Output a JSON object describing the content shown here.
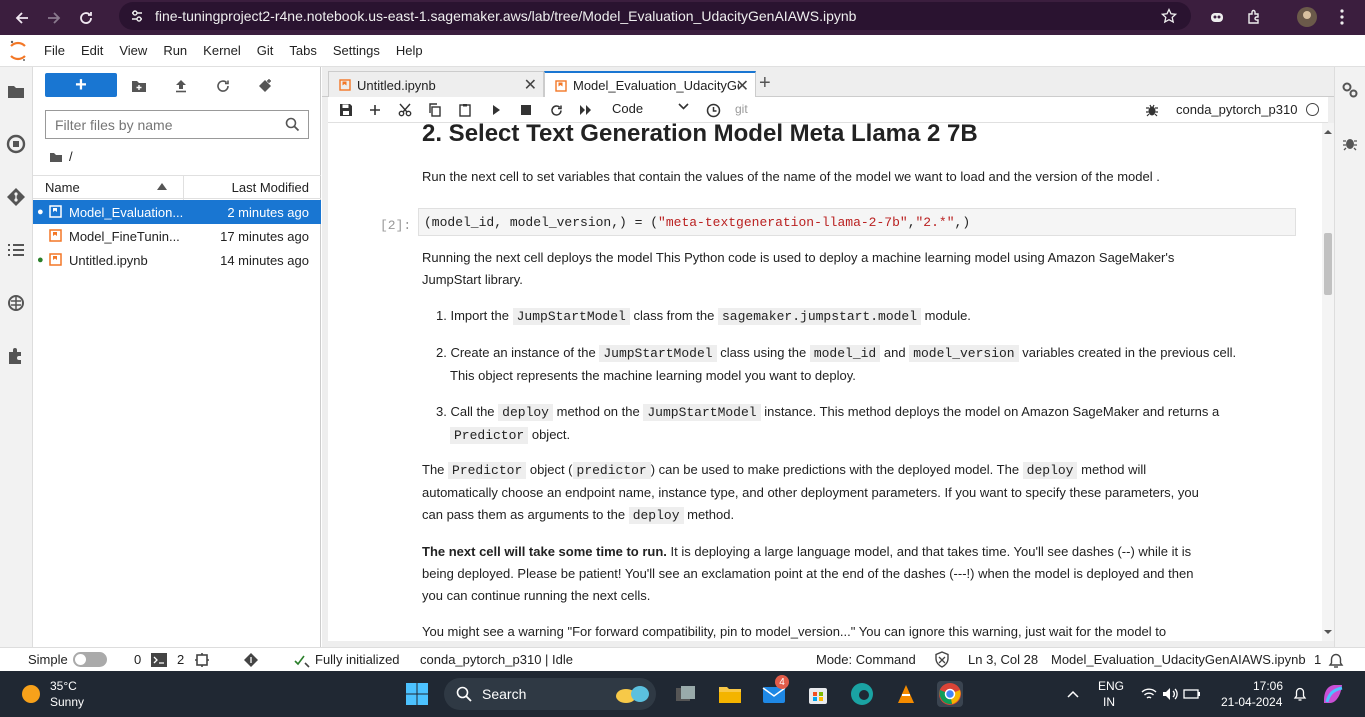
{
  "browser": {
    "url": "fine-tuningproject2-r4ne.notebook.us-east-1.sagemaker.aws/lab/tree/Model_Evaluation_UdacityGenAIAWS.ipynb"
  },
  "menu": [
    "File",
    "Edit",
    "View",
    "Run",
    "Kernel",
    "Git",
    "Tabs",
    "Settings",
    "Help"
  ],
  "file_browser": {
    "new_label": "+",
    "filter_placeholder": "Filter files by name",
    "path": "/",
    "header_name": "Name",
    "header_modified": "Last Modified",
    "files": [
      {
        "name": "Model_Evaluation...",
        "modified": "2 minutes ago",
        "running": true,
        "selected": true
      },
      {
        "name": "Model_FineTunin...",
        "modified": "17 minutes ago",
        "running": false,
        "selected": false
      },
      {
        "name": "Untitled.ipynb",
        "modified": "14 minutes ago",
        "running": true,
        "selected": false
      }
    ]
  },
  "tabs": [
    {
      "label": "Untitled.ipynb",
      "active": false
    },
    {
      "label": "Model_Evaluation_UdacityGe",
      "active": true
    }
  ],
  "toolbar": {
    "cell_type": "Code",
    "git": "git",
    "kernel": "conda_pytorch_p310"
  },
  "notebook": {
    "heading": "2. Select Text Generation Model Meta Llama 2 7B",
    "p1": "Run the next cell to set variables that contain the values of the name of the model we want to load and the version of the model .",
    "prompt": "[2]:",
    "code_pre": "(model_id, model_version,) = (",
    "code_str1": "\"meta-textgeneration-llama-2-7b\"",
    "code_mid": ",",
    "code_str2": "\"2.*\"",
    "code_post": ",)",
    "p2a": "Running the next cell deploys the model This Python code is used to deploy a machine learning model using Amazon SageMaker's",
    "p2b": "JumpStart library.",
    "li1_a": "1. Import the",
    "li1_c1": "JumpStartModel",
    "li1_b": "class from the",
    "li1_c2": "sagemaker.jumpstart.model",
    "li1_d": "module.",
    "li2_a": "2. Create an instance of the",
    "li2_c1": "JumpStartModel",
    "li2_b": "class using the",
    "li2_c2": "model_id",
    "li2_and": "and",
    "li2_c3": "model_version",
    "li2_d": "variables created in the previous cell.",
    "li2_e": "This object represents the machine learning model you want to deploy.",
    "li3_a": "3. Call the",
    "li3_c1": "deploy",
    "li3_b": "method on the",
    "li3_c2": "JumpStartModel",
    "li3_d": "instance. This method deploys the model on Amazon SageMaker and returns a",
    "li3_c3": "Predictor",
    "li3_e": "object.",
    "p3_a": "The",
    "p3_c1": "Predictor",
    "p3_b": "object (",
    "p3_c2": "predictor",
    "p3_c": ") can be used to make predictions with the deployed model. The",
    "p3_c3": "deploy",
    "p3_d": "method will",
    "p3_e": "automatically choose an endpoint name, instance type, and other deployment parameters. If you want to specify these parameters, you",
    "p3_f": "can pass them as arguments to the",
    "p3_c4": "deploy",
    "p3_g": "method.",
    "p4_bold": "The next cell will take some time to run.",
    "p4_a": " It is deploying a large language model, and that takes time. You'll see dashes (--) while it is",
    "p4_b": "being deployed. Please be patient! You'll see an exclamation point at the end of the dashes (---!) when the model is deployed and then",
    "p4_c": "you can continue running the next cells.",
    "p5": "You might see a warning \"For forward compatibility, pin to model_version...\" You can ignore this warning, just wait for the model to"
  },
  "status": {
    "mode_label": "Simple",
    "terminals": "0",
    "kernels": "2",
    "init": "Fully initialized",
    "kernel_status": "conda_pytorch_p310 | Idle",
    "mode": "Mode: Command",
    "position": "Ln 3, Col 28",
    "file": "Model_Evaluation_UdacityGenAIAWS.ipynb",
    "notifications": "1"
  },
  "taskbar": {
    "temp": "35°C",
    "weather": "Sunny",
    "search": "Search",
    "mail_badge": "4",
    "lang1": "ENG",
    "lang2": "IN",
    "time": "17:06",
    "date": "21-04-2024"
  }
}
